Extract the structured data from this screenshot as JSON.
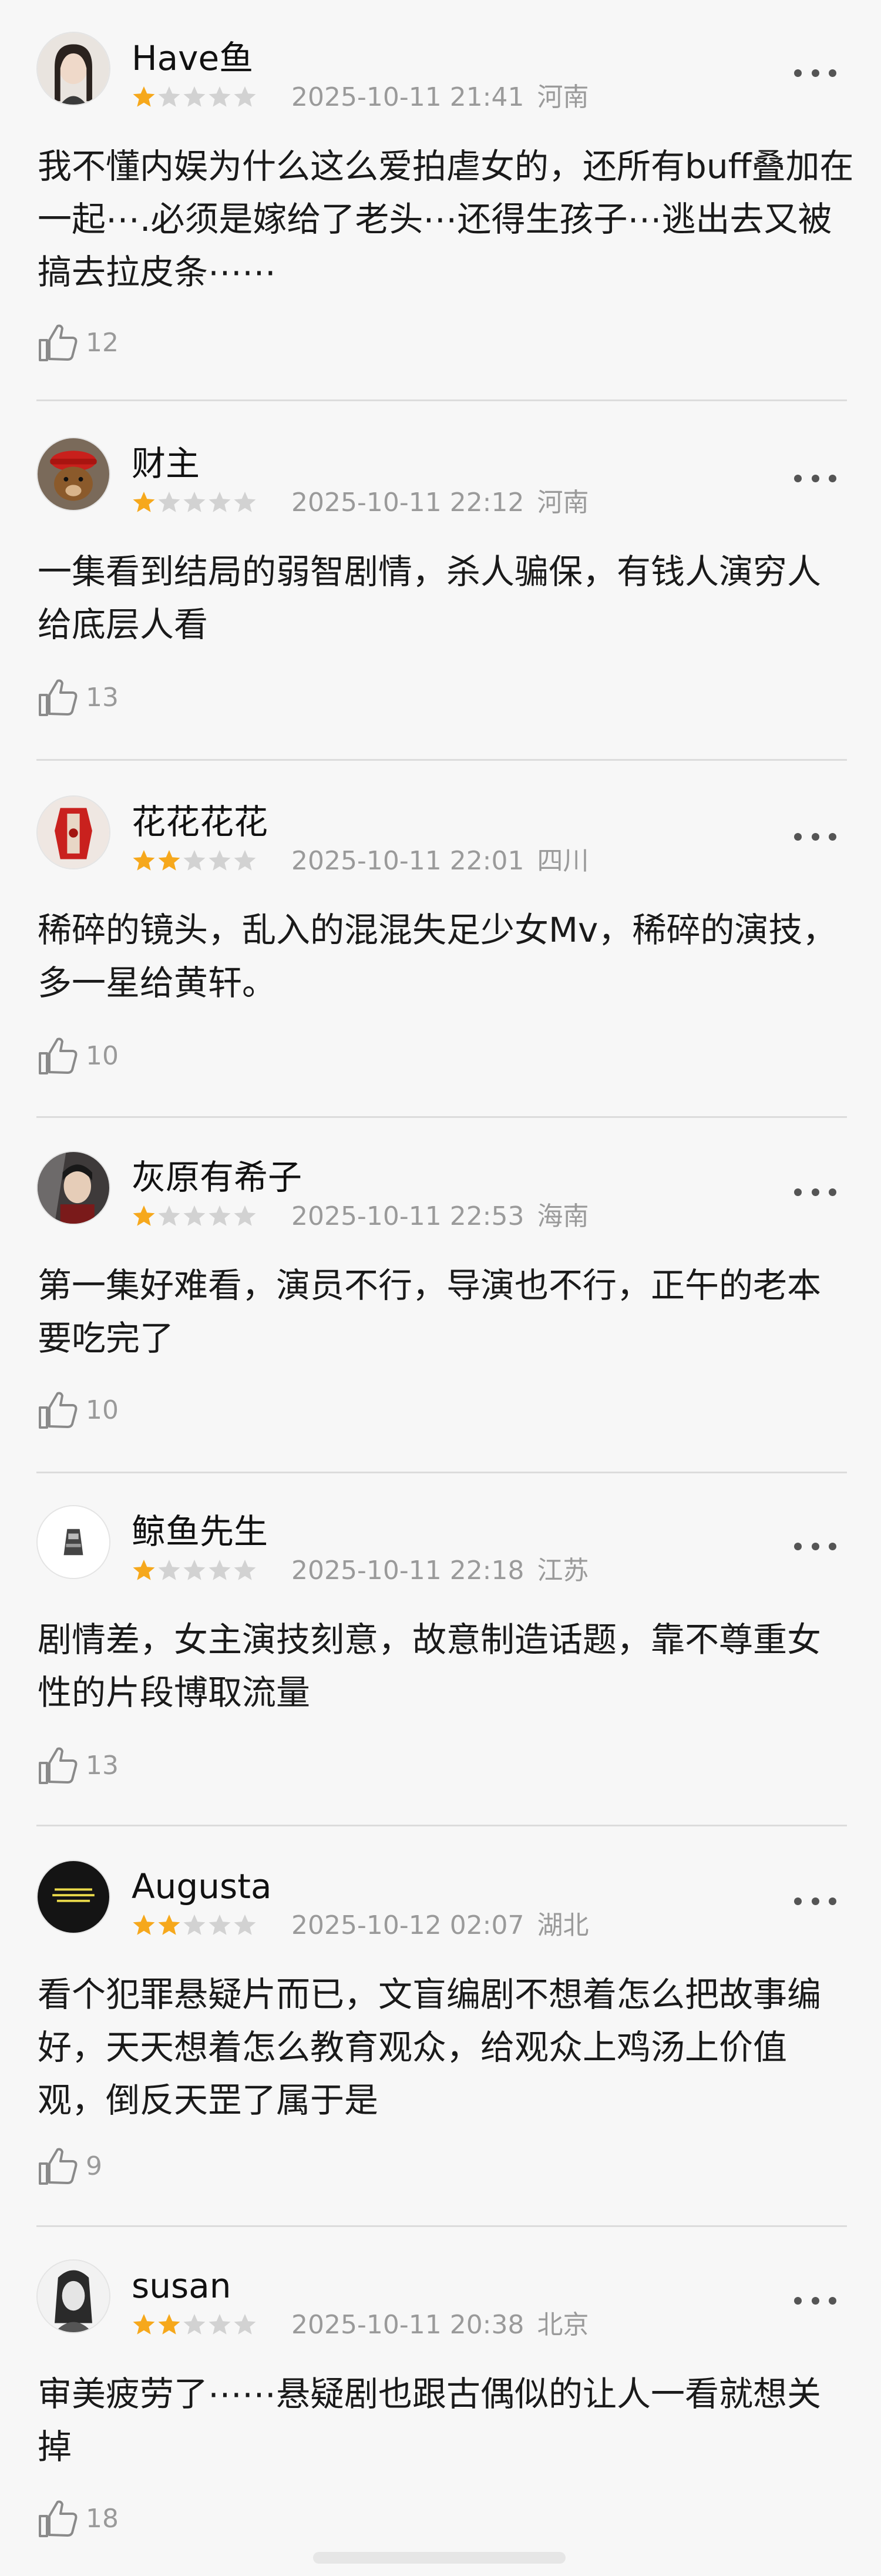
{
  "colors": {
    "star_filled": "#f6a81c",
    "star_empty": "#d2d2d2",
    "meta_text": "#9a9a9a",
    "divider": "#dcdcdc"
  },
  "icons": {
    "like": "thumbs-up-icon",
    "more": "more-dots-icon",
    "star": "star-icon"
  },
  "comments": [
    {
      "user": "Have鱼",
      "rating": 1,
      "date": "2025-10-11 21:41",
      "location": "河南",
      "text": "我不懂内娱为什么这么爱拍虐女的，还所有buff叠加在一起⋯.必须是嫁给了老头⋯还得生孩子⋯逃出去又被搞去拉皮条⋯⋯",
      "likes": "12"
    },
    {
      "user": "财主",
      "rating": 1,
      "date": "2025-10-11 22:12",
      "location": "河南",
      "text": "一集看到结局的弱智剧情，杀人骗保，有钱人演穷人给底层人看",
      "likes": "13"
    },
    {
      "user": "花花花花",
      "rating": 2,
      "date": "2025-10-11 22:01",
      "location": "四川",
      "text": "稀碎的镜头，乱入的混混失足少女Mv，稀碎的演技，多一星给黄轩。",
      "likes": "10"
    },
    {
      "user": "灰原有希子",
      "rating": 1,
      "date": "2025-10-11 22:53",
      "location": "海南",
      "text": "第一集好难看，演员不行，导演也不行，正午的老本要吃完了",
      "likes": "10"
    },
    {
      "user": "鲸鱼先生",
      "rating": 1,
      "date": "2025-10-11 22:18",
      "location": "江苏",
      "text": "剧情差，女主演技刻意，故意制造话题，靠不尊重女性的片段博取流量",
      "likes": "13"
    },
    {
      "user": "Augusta",
      "rating": 2,
      "date": "2025-10-12 02:07",
      "location": "湖北",
      "text": "看个犯罪悬疑片而已，文盲编剧不想着怎么把故事编好，天天想着怎么教育观众，给观众上鸡汤上价值观，倒反天罡了属于是",
      "likes": "9"
    },
    {
      "user": "susan",
      "rating": 2,
      "date": "2025-10-11 20:38",
      "location": "北京",
      "text": "审美疲劳了⋯⋯悬疑剧也跟古偶似的让人一看就想关掉",
      "likes": "18"
    }
  ]
}
